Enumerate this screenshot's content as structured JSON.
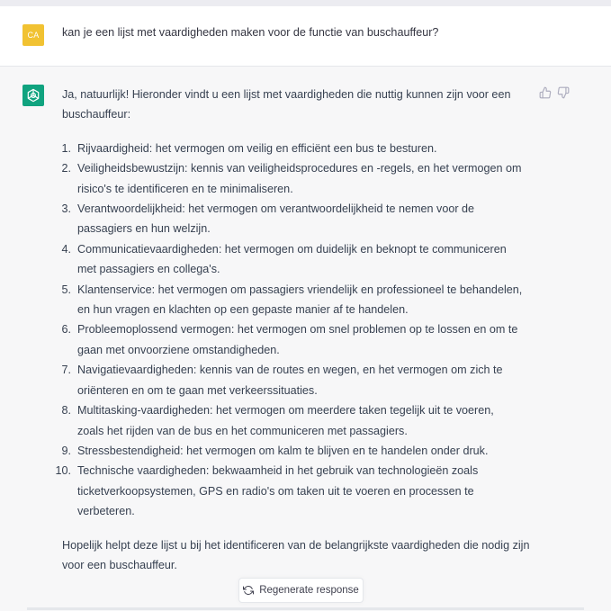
{
  "user_message": {
    "avatar_initials": "CA",
    "text": "kan je een lijst met vaardigheden maken voor de functie van buschauffeur?"
  },
  "assistant_message": {
    "avatar_icon": "openai-logo-icon",
    "intro": "Ja, natuurlijk! Hieronder vindt u een lijst met vaardigheden die nuttig kunnen zijn voor een buschauffeur:",
    "list": [
      {
        "number": "1.",
        "line1": "Rijvaardigheid: het vermogen om veilig en efficiënt een bus te besturen.",
        "line2": ""
      },
      {
        "number": "2.",
        "line1": "Veiligheidsbewustzijn: kennis van veiligheidsprocedures en -regels, en het vermogen om",
        "line2": "risico's te identificeren en te minimaliseren."
      },
      {
        "number": "3.",
        "line1": "Verantwoordelijkheid: het vermogen om verantwoordelijkheid te nemen voor de",
        "line2": "passagiers en hun welzijn."
      },
      {
        "number": "4.",
        "line1": "Communicatievaardigheden: het vermogen om duidelijk en beknopt te communiceren",
        "line2": "met passagiers en collega's."
      },
      {
        "number": "5.",
        "line1": "Klantenservice: het vermogen om passagiers vriendelijk en professioneel te behandelen,",
        "line2": "en hun vragen en klachten op een gepaste manier af te handelen."
      },
      {
        "number": "6.",
        "line1": "Probleemoplossend vermogen: het vermogen om snel problemen op te lossen en om te",
        "line2": "gaan met onvoorziene omstandigheden."
      },
      {
        "number": "7.",
        "line1": "Navigatievaardigheden: kennis van de routes en wegen, en het vermogen om zich te",
        "line2": "oriënteren en om te gaan met verkeerssituaties."
      },
      {
        "number": "8.",
        "line1": "Multitasking-vaardigheden: het vermogen om meerdere taken tegelijk uit te voeren,",
        "line2": "zoals het rijden van de bus en het communiceren met passagiers."
      },
      {
        "number": "9.",
        "line1": "Stressbestendigheid: het vermogen om kalm te blijven en te handelen onder druk.",
        "line2": ""
      },
      {
        "number": "10.",
        "line1": "Technische vaardigheden: bekwaamheid in het gebruik van technologieën zoals",
        "line2": "ticketverkoopsystemen, GPS en radio's om taken uit te voeren en processen te",
        "line3": "verbeteren."
      }
    ],
    "outro": "Hopelijk helpt deze lijst u bij het identificeren van de belangrijkste vaardigheden die nodig zijn voor een buschauffeur."
  },
  "feedback": {
    "thumbs_up_icon": "thumbs-up-icon",
    "thumbs_down_icon": "thumbs-down-icon"
  },
  "regenerate": {
    "label": "Regenerate response",
    "icon": "refresh-icon"
  },
  "colors": {
    "user_avatar": "#f1c232",
    "assistant_avatar": "#10a37f",
    "assistant_bg": "#f7f7f8",
    "user_bg": "#ffffff"
  }
}
